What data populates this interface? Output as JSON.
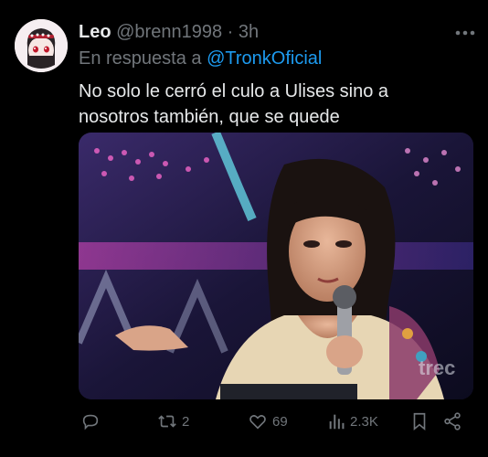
{
  "tweet": {
    "display_name": "Leo",
    "handle": "@brenn1998",
    "separator": "·",
    "time": "3h",
    "reply_prefix": "En respuesta a",
    "reply_to": "@TronkOficial",
    "text": "No solo le cerró el culo a Ulises sino a nosotros también, que se quede",
    "watermark": "trec"
  },
  "actions": {
    "reply_count": "",
    "retweet_count": "2",
    "like_count": "69",
    "view_count": "2.3K"
  },
  "icons": {
    "more": "more-icon",
    "reply": "reply-icon",
    "retweet": "retweet-icon",
    "like": "heart-icon",
    "views": "views-icon",
    "bookmark": "bookmark-icon",
    "share": "share-icon"
  },
  "colors": {
    "background": "#000000",
    "primary_text": "#e7e9ea",
    "secondary_text": "#71767b",
    "accent": "#1d9bf0"
  }
}
